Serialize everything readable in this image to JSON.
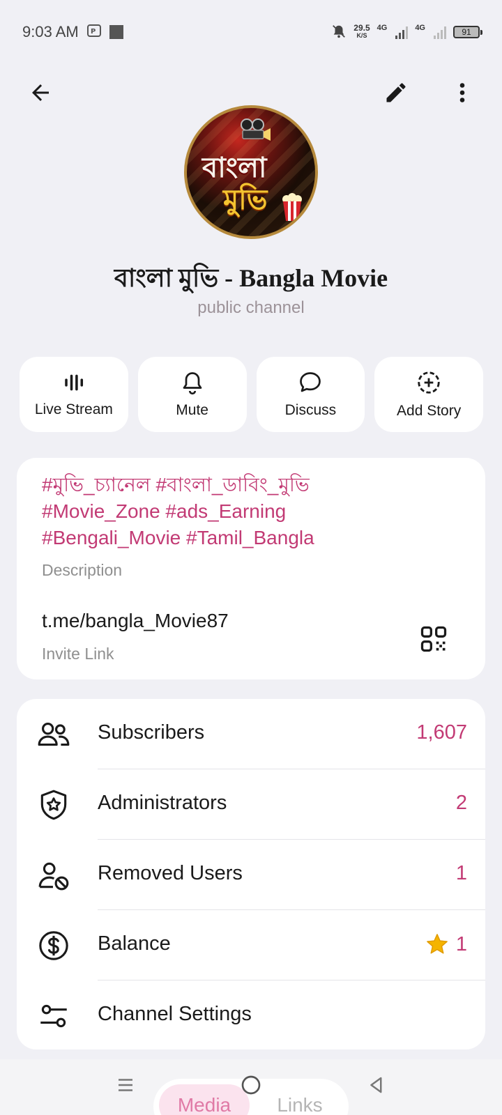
{
  "status_bar": {
    "time": "9:03 AM",
    "speed_value": "29.5",
    "speed_unit": "K/S",
    "network_1": "4G",
    "network_2": "4G",
    "battery": "91"
  },
  "avatar": {
    "logo_line1": "বাংলা",
    "logo_line2": "মুভি"
  },
  "channel": {
    "title": "বাংলা মুভি - Bangla Movie",
    "subtitle": "public channel"
  },
  "actions": [
    {
      "label": "Live Stream",
      "icon": "live-stream-icon"
    },
    {
      "label": "Mute",
      "icon": "bell-icon"
    },
    {
      "label": "Discuss",
      "icon": "chat-bubble-icon"
    },
    {
      "label": "Add Story",
      "icon": "add-story-icon"
    }
  ],
  "info": {
    "description_lines": [
      "#মুভি_চ্যানেল #বাংলা_ডাবিং_মুভি",
      "#Movie_Zone #ads_Earning",
      "#Bengali_Movie #Tamil_Bangla"
    ],
    "description_label": "Description",
    "invite_link": "t.me/bangla_Movie87",
    "invite_label": "Invite Link"
  },
  "rows": [
    {
      "label": "Subscribers",
      "value": "1,607",
      "icon": "subscribers-icon"
    },
    {
      "label": "Administrators",
      "value": "2",
      "icon": "admin-shield-icon"
    },
    {
      "label": "Removed Users",
      "value": "1",
      "icon": "removed-user-icon"
    },
    {
      "label": "Balance",
      "value": "1",
      "icon": "dollar-icon"
    },
    {
      "label": "Channel Settings",
      "value": "",
      "icon": "settings-sliders-icon"
    }
  ],
  "tabs": {
    "media": "Media",
    "links": "Links"
  },
  "colors": {
    "accent": "#c23a74",
    "background": "#f0f0f5",
    "card": "#ffffff"
  }
}
